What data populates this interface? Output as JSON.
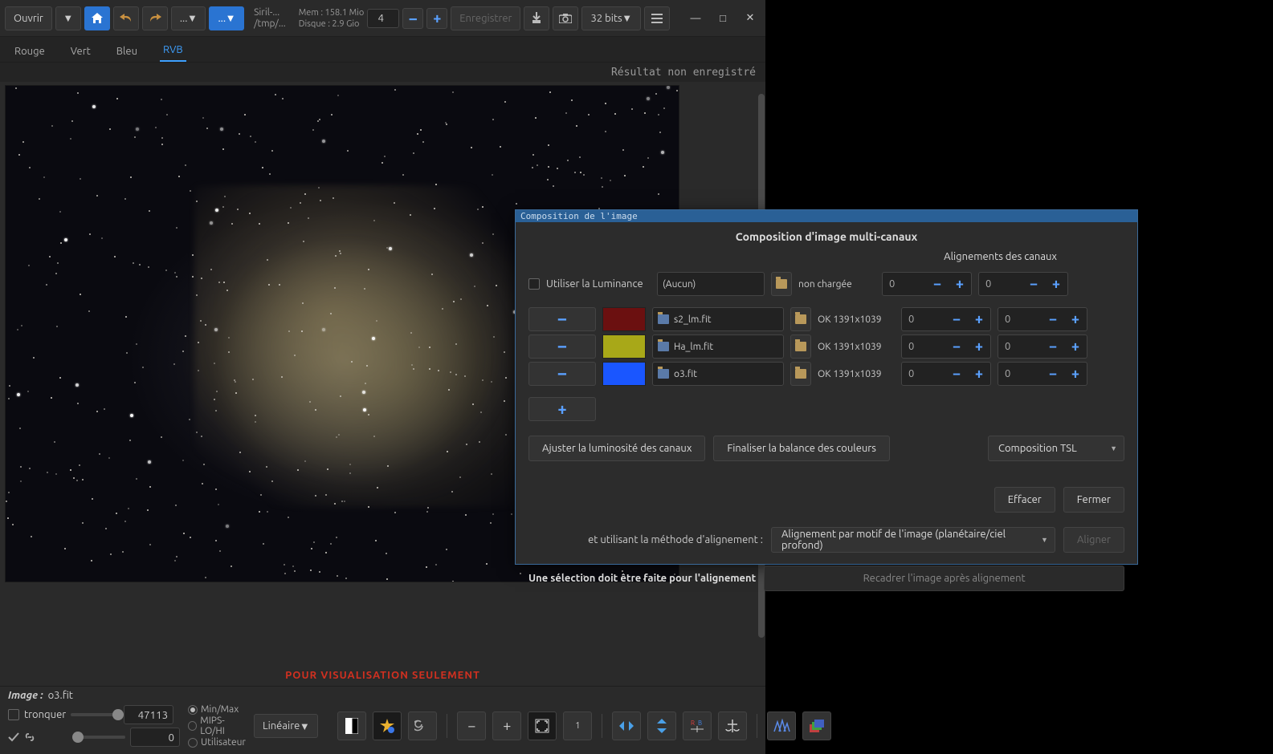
{
  "toolbar": {
    "open": "Ouvrir",
    "menu1": "...",
    "menu2": "...",
    "title_top": "Siril-...",
    "title_bot": "/tmp/...",
    "mem_label": "Mem : 158.1 Mio",
    "disk_label": "Disque : 2.9 Gio",
    "scale_value": "4",
    "save": "Enregistrer",
    "bits": "32 bits"
  },
  "tabs": {
    "rouge": "Rouge",
    "vert": "Vert",
    "bleu": "Bleu",
    "rvb": "RVB"
  },
  "status_unsaved": "Résultat non enregistré",
  "vis_only": "POUR VISUALISATION SEULEMENT",
  "bottom": {
    "image_label": "Image :",
    "image_file": "o3.fit",
    "tronquer": "tronquer",
    "val_hi": "47113",
    "val_lo": "0",
    "minmax": "Min/Max",
    "mips": "MIPS-LO/HI",
    "user": "Utilisateur",
    "linear": "Linéaire"
  },
  "dialog": {
    "title": "Composition de l'image",
    "heading": "Composition d'image multi-canaux",
    "align_header": "Alignements des canaux",
    "use_luminance": "Utiliser la Luminance",
    "none": "(Aucun)",
    "not_loaded": "non chargée",
    "channels": [
      {
        "color": "#6b1010",
        "file": "s2_lm.fit",
        "status": "OK 1391x1039"
      },
      {
        "color": "#a8a818",
        "file": "Ha_lm.fit",
        "status": "OK 1391x1039"
      },
      {
        "color": "#1a56ff",
        "file": "o3.fit",
        "status": "OK 1391x1039"
      }
    ],
    "spin_zero": "0",
    "adjust_lum": "Ajuster la luminosité des canaux",
    "finalize": "Finaliser la balance des couleurs",
    "comp_mode": "Composition TSL",
    "erase": "Effacer",
    "close": "Fermer",
    "align_method_label": "et utilisant la méthode d'alignement :",
    "align_method": "Alignement par motif de l'image (planétaire/ciel profond)",
    "align_btn": "Aligner",
    "warn": "Une sélection doit être faite pour l'alignement",
    "recrop": "Recadrer l'image après alignement"
  }
}
